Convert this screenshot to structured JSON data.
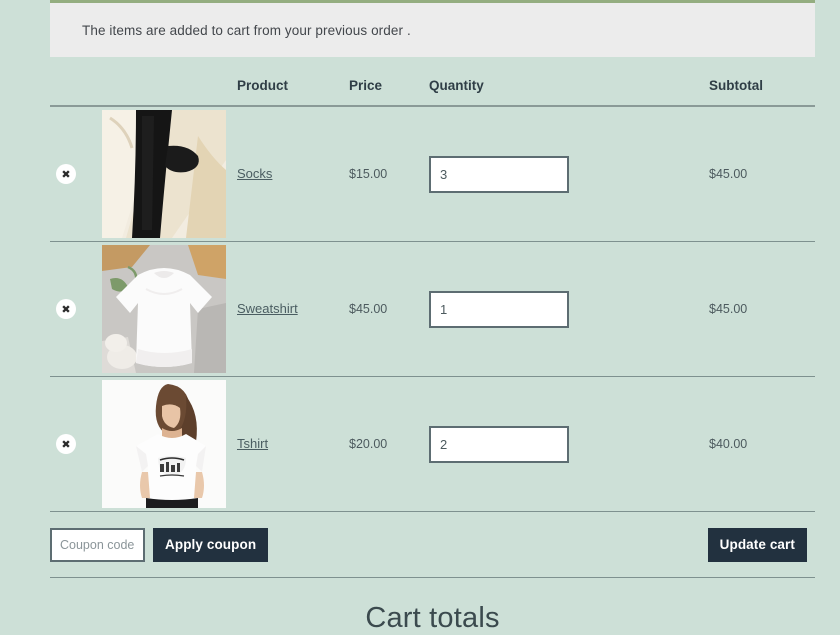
{
  "notice": {
    "message": "The items are added to cart from your previous order ."
  },
  "cart": {
    "headers": {
      "remove": "",
      "thumb": "",
      "product": "Product",
      "price": "Price",
      "quantity": "Quantity",
      "subtotal": "Subtotal"
    },
    "remove_icon": "close-icon",
    "remove_glyph": "✖",
    "items": [
      {
        "name": "Socks",
        "price": "$15.00",
        "quantity": "3",
        "subtotal": "$45.00",
        "thumb_alt": "black-socks-on-white-cloth"
      },
      {
        "name": "Sweatshirt",
        "price": "$45.00",
        "quantity": "1",
        "subtotal": "$45.00",
        "thumb_alt": "white-sweatshirt-flat-lay"
      },
      {
        "name": "Tshirt",
        "price": "$20.00",
        "quantity": "2",
        "subtotal": "$40.00",
        "thumb_alt": "woman-wearing-graphic-tshirt"
      }
    ]
  },
  "actions": {
    "coupon_placeholder": "Coupon code",
    "coupon_value": "",
    "apply_label": "Apply coupon",
    "update_label": "Update cart"
  },
  "totals": {
    "heading": "Cart totals"
  },
  "colors": {
    "page_background": "#cde0d7",
    "notice_background": "#ececec",
    "notice_border": "#94ad80",
    "button_dark": "#22313f",
    "text_primary": "#3d4f52",
    "input_border": "#5d6d72"
  }
}
